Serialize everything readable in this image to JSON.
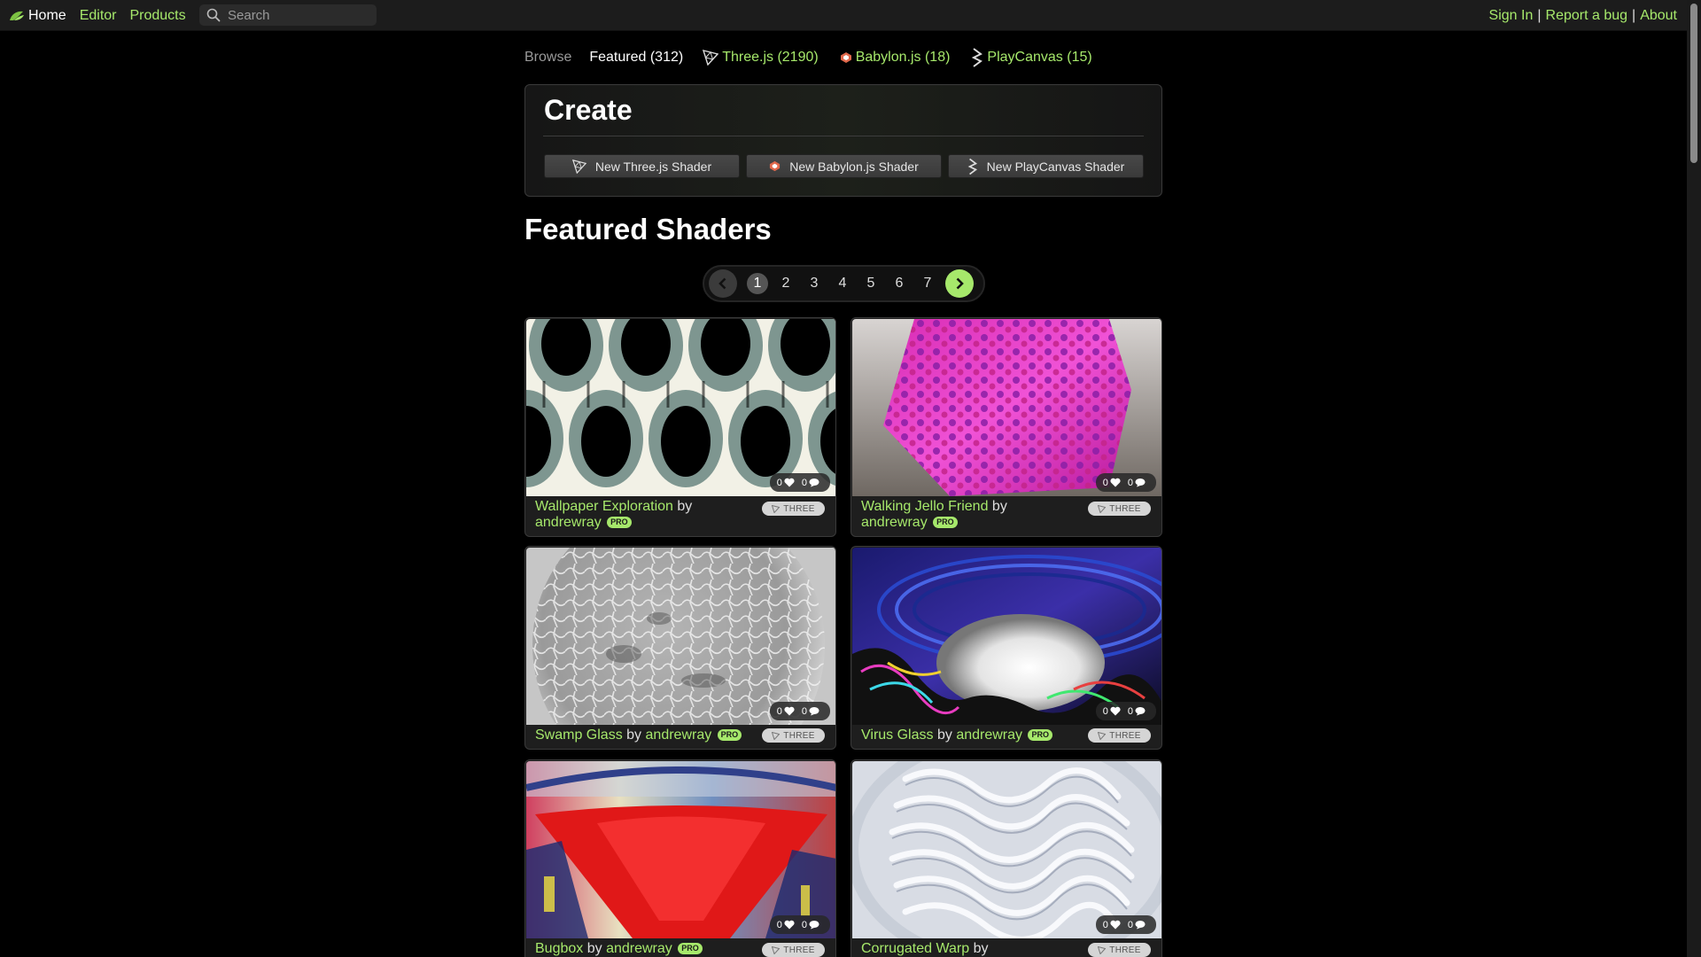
{
  "nav": {
    "home": "Home",
    "editor": "Editor",
    "products": "Products",
    "search_placeholder": "Search",
    "sign_in": "Sign In",
    "sep": "|",
    "report_bug": "Report a bug",
    "about": "About"
  },
  "browse": {
    "label": "Browse",
    "featured": "Featured (312)",
    "threejs": "Three.js (2190)",
    "babylonjs": "Babylon.js (18)",
    "playcanvas": "PlayCanvas (15)"
  },
  "create": {
    "title": "Create",
    "new_threejs": "New Three.js Shader",
    "new_babylonjs": "New Babylon.js Shader",
    "new_playcanvas": "New PlayCanvas Shader"
  },
  "featured_title": "Featured Shaders",
  "pagination": {
    "current": "1",
    "pages": [
      "2",
      "3",
      "4",
      "5",
      "6",
      "7"
    ]
  },
  "cards": [
    {
      "title": "Wallpaper Exploration",
      "by": "by",
      "author": "andrewray",
      "pro": "PRO",
      "likes": "0",
      "comments": "0",
      "engine": "THREE"
    },
    {
      "title": "Walking Jello Friend",
      "by": "by",
      "author": "andrewray",
      "pro": "PRO",
      "likes": "0",
      "comments": "0",
      "engine": "THREE"
    },
    {
      "title": "Swamp Glass",
      "by": "by",
      "author": "andrewray",
      "pro": "PRO",
      "likes": "0",
      "comments": "0",
      "engine": "THREE"
    },
    {
      "title": "Virus Glass",
      "by": "by",
      "author": "andrewray",
      "pro": "PRO",
      "likes": "0",
      "comments": "0",
      "engine": "THREE"
    },
    {
      "title": "Bugbox",
      "by": "by",
      "author": "andrewray",
      "pro": "PRO",
      "likes": "0",
      "comments": "0",
      "engine": "THREE"
    },
    {
      "title": "Corrugated Warp",
      "by": "by",
      "author": "",
      "pro": "",
      "likes": "0",
      "comments": "0",
      "engine": "THREE"
    }
  ],
  "colors": {
    "accent": "#a6e86b",
    "background": "#000000",
    "topbar": "#1c1c1c"
  },
  "icons": [
    "home-logo-icon",
    "search-icon",
    "threejs-icon",
    "babylonjs-icon",
    "playcanvas-icon",
    "chevron-left-icon",
    "chevron-right-icon",
    "heart-icon",
    "comment-icon"
  ]
}
